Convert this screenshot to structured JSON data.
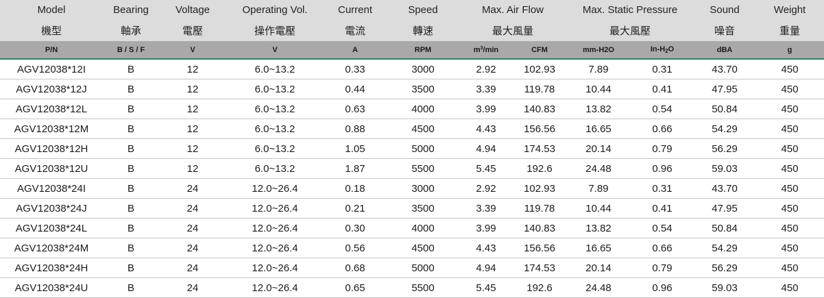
{
  "header_en": [
    "Model",
    "Bearing",
    "Voltage",
    "Operating Vol.",
    "Current",
    "Speed",
    "Max. Air Flow",
    "Max. Static Pressure",
    "Sound",
    "Weight"
  ],
  "header_zh": [
    "機型",
    "軸承",
    "電壓",
    "操作電壓",
    "電流",
    "轉速",
    "最大風量",
    "最大風壓",
    "噪音",
    "重量"
  ],
  "units": {
    "pn": "P/N",
    "bearing": "B / S / F",
    "voltage": "V",
    "op_voltage": "V",
    "current": "A",
    "speed": "RPM",
    "airflow_m3_base": "m",
    "airflow_m3_sup": "3",
    "airflow_m3_rest": "/min",
    "airflow_cfm": "CFM",
    "pressure_mmh2o": "mm-H2O",
    "pressure_inh2o_base": "In-H",
    "pressure_inh2o_sub": "2",
    "pressure_inh2o_rest": "O",
    "sound": "dBA",
    "weight": "g"
  },
  "rows": [
    [
      "AGV12038*12I",
      "B",
      "12",
      "6.0~13.2",
      "0.33",
      "3000",
      "2.92",
      "102.93",
      "7.89",
      "0.31",
      "43.70",
      "450"
    ],
    [
      "AGV12038*12J",
      "B",
      "12",
      "6.0~13.2",
      "0.44",
      "3500",
      "3.39",
      "119.78",
      "10.44",
      "0.41",
      "47.95",
      "450"
    ],
    [
      "AGV12038*12L",
      "B",
      "12",
      "6.0~13.2",
      "0.63",
      "4000",
      "3.99",
      "140.83",
      "13.82",
      "0.54",
      "50.84",
      "450"
    ],
    [
      "AGV12038*12M",
      "B",
      "12",
      "6.0~13.2",
      "0.88",
      "4500",
      "4.43",
      "156.56",
      "16.65",
      "0.66",
      "54.29",
      "450"
    ],
    [
      "AGV12038*12H",
      "B",
      "12",
      "6.0~13.2",
      "1.05",
      "5000",
      "4.94",
      "174.53",
      "20.14",
      "0.79",
      "56.29",
      "450"
    ],
    [
      "AGV12038*12U",
      "B",
      "12",
      "6.0~13.2",
      "1.87",
      "5500",
      "5.45",
      "192.6",
      "24.48",
      "0.96",
      "59.03",
      "450"
    ],
    [
      "AGV12038*24I",
      "B",
      "24",
      "12.0~26.4",
      "0.18",
      "3000",
      "2.92",
      "102.93",
      "7.89",
      "0.31",
      "43.70",
      "450"
    ],
    [
      "AGV12038*24J",
      "B",
      "24",
      "12.0~26.4",
      "0.21",
      "3500",
      "3.39",
      "119.78",
      "10.44",
      "0.41",
      "47.95",
      "450"
    ],
    [
      "AGV12038*24L",
      "B",
      "24",
      "12.0~26.4",
      "0.30",
      "4000",
      "3.99",
      "140.83",
      "13.82",
      "0.54",
      "50.84",
      "450"
    ],
    [
      "AGV12038*24M",
      "B",
      "24",
      "12.0~26.4",
      "0.56",
      "4500",
      "4.43",
      "156.56",
      "16.65",
      "0.66",
      "54.29",
      "450"
    ],
    [
      "AGV12038*24H",
      "B",
      "24",
      "12.0~26.4",
      "0.68",
      "5000",
      "4.94",
      "174.53",
      "20.14",
      "0.79",
      "56.29",
      "450"
    ],
    [
      "AGV12038*24U",
      "B",
      "24",
      "12.0~26.4",
      "0.65",
      "5500",
      "5.45",
      "192.6",
      "24.48",
      "0.96",
      "59.03",
      "450"
    ]
  ]
}
